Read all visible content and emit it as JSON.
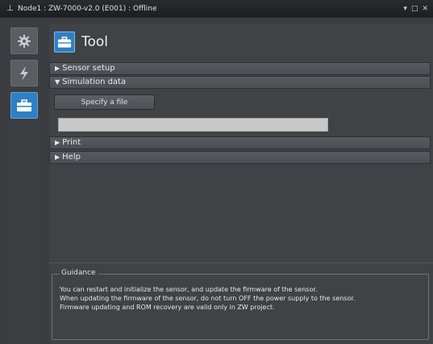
{
  "window": {
    "title": "Node1 : ZW-7000-v2.0 (E001) : Offline",
    "controls": [
      "▾",
      "□",
      "✕"
    ]
  },
  "sidebar": {
    "items": [
      {
        "icon": "gear-icon"
      },
      {
        "icon": "lightning-icon"
      },
      {
        "icon": "toolbox-icon",
        "active": true
      }
    ]
  },
  "tool": {
    "title": "Tool"
  },
  "sections": {
    "sensor_setup": "Sensor setup",
    "simulation_data": "Simulation data",
    "print": "Print",
    "help": "Help"
  },
  "simulation": {
    "specify_button": "Specify a file",
    "file_value": ""
  },
  "guidance": {
    "label": "Guidance",
    "line1": "You can restart and initialize the sensor, and update the firmware of the sensor.",
    "line2": "When updating the firmware of the sensor, do not turn OFF the power supply to the sensor.",
    "line3": "Firmware updating and ROM recovery are valid only in ZW project."
  },
  "colors": {
    "accent": "#2f7fc4",
    "background": "#404246"
  }
}
